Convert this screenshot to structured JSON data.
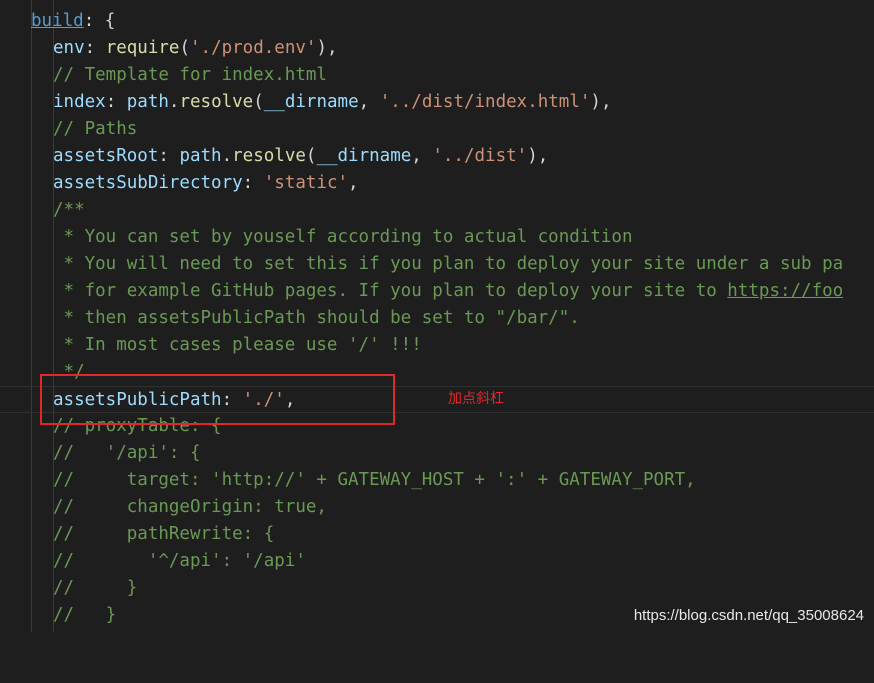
{
  "code_lines": [
    {
      "key": "build",
      "brace": ": {"
    },
    {
      "prop": "env",
      "rest_fn": "require",
      "rest_str": "'./prod.env'"
    },
    {
      "comment": "// Template for index.html"
    },
    {
      "prop": "index",
      "obj": "path",
      "fn": "resolve",
      "ident": "__dirname",
      "str": "'../dist/index.html'"
    },
    {
      "comment": "// Paths"
    },
    {
      "prop": "assetsRoot",
      "obj": "path",
      "fn": "resolve",
      "ident": "__dirname",
      "str": "'../dist'"
    },
    {
      "prop": "assetsSubDirectory",
      "str": "'static'"
    },
    {
      "comment": "/**"
    },
    {
      "comment": " * You can set by youself according to actual condition"
    },
    {
      "comment": " * You will need to set this if you plan to deploy your site under a sub pa"
    },
    {
      "comment_pre": " * for example GitHub pages. If you plan to deploy your site to ",
      "comment_link": "https://foo"
    },
    {
      "comment": " * then assetsPublicPath should be set to \"/bar/\"."
    },
    {
      "comment": " * In most cases please use '/' !!!"
    },
    {
      "comment": " */"
    },
    {
      "prop": "assetsPublicPath",
      "str": "'./'"
    },
    {
      "comment": "// proxyTable: {"
    },
    {
      "comment": "//   '/api': {"
    },
    {
      "comment": "//     target: 'http://' + GATEWAY_HOST + ':' + GATEWAY_PORT,"
    },
    {
      "comment": "//     changeOrigin: true,"
    },
    {
      "comment": "//     pathRewrite: {"
    },
    {
      "comment": "//       '^/api': '/api'"
    },
    {
      "comment": "//     }"
    },
    {
      "comment": "//   }"
    }
  ],
  "annotation": {
    "label": "加点斜杠"
  },
  "watermark": "https://blog.csdn.net/qq_35008624",
  "colors": {
    "annotation": "#e0272b",
    "background": "#1e1e1e"
  }
}
